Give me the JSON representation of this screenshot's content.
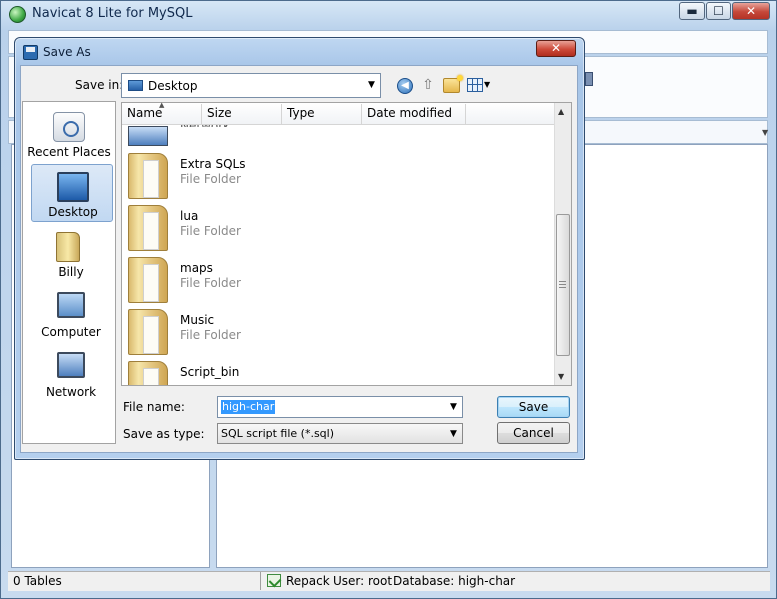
{
  "main_window": {
    "title": "Navicat 8 Lite for MySQL",
    "controls": {
      "minimize": "▬",
      "maximize": "☐",
      "close": "✕"
    }
  },
  "status_bar": {
    "tables": "0 Tables",
    "action": "Repack",
    "user": "User: root",
    "database": "Database: high-char"
  },
  "dialog": {
    "title": "Save As",
    "close_glyph": "✕",
    "save_in": {
      "label": "Save in:",
      "value": "Desktop"
    },
    "places": [
      {
        "label": "Recent Places",
        "icon": "recent-places-icon"
      },
      {
        "label": "Desktop",
        "icon": "desktop-icon",
        "selected": true
      },
      {
        "label": "Billy",
        "icon": "user-folder-icon"
      },
      {
        "label": "Computer",
        "icon": "computer-icon"
      },
      {
        "label": "Network",
        "icon": "network-icon"
      }
    ],
    "columns": [
      "Name",
      "Size",
      "Type",
      "Date modified"
    ],
    "partial_row": "Network",
    "files": [
      {
        "name": "Extra SQLs",
        "type": "File Folder"
      },
      {
        "name": "lua",
        "type": "File Folder"
      },
      {
        "name": "maps",
        "type": "File Folder"
      },
      {
        "name": "Music",
        "type": "File Folder"
      },
      {
        "name": "Script_bin",
        "type": ""
      }
    ],
    "file_name": {
      "label": "File name:",
      "value": "high-char"
    },
    "save_as_type": {
      "label": "Save as type:",
      "value": "SQL script file (*.sql)"
    },
    "buttons": {
      "save": "Save",
      "cancel": "Cancel"
    }
  },
  "colors": {
    "selection": "#3399ff",
    "title_bar": "#bfd7f1",
    "close_button": "#cd4a39"
  }
}
